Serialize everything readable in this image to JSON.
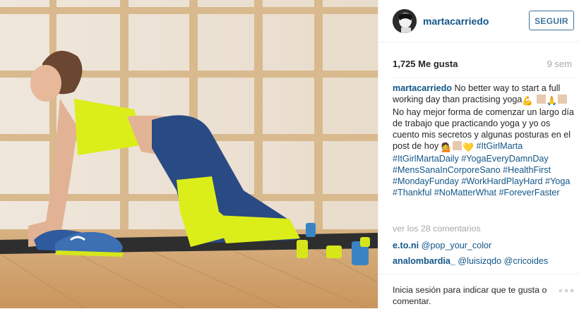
{
  "post": {
    "username": "martacarriedo",
    "follow_label": "SEGUIR",
    "likes": "1,725 Me gusta",
    "time": "9 sem",
    "caption": {
      "username": "martacarriedo",
      "line1": "No better way to start a full working day than practising yoga",
      "line2": "No hay mejor forma de comenzar un largo día de trabajo que practicando yoga y yo os cuento mis secretos y algunas posturas en el post de hoy",
      "hashtags": "#ItGirlMarta #ItGirlMartaDaily #YogaEveryDamnDay #MensSanaInCorporeSano #HealthFirst #MondayFunday #WorkHardPlayHard #Yoga #Thankful #NoMatterWhat #ForeverFaster"
    },
    "view_comments": "ver los 28 comentarios",
    "comments": [
      {
        "username": "e.to.ni",
        "text": "@pop_your_color"
      },
      {
        "username": "analombardia_",
        "text": "@luisizqdo @cricoides"
      }
    ],
    "login_prompt": "Inicia sesión para indicar que te gusta o comentar.",
    "more_icon": "ellipsis-icon"
  }
}
